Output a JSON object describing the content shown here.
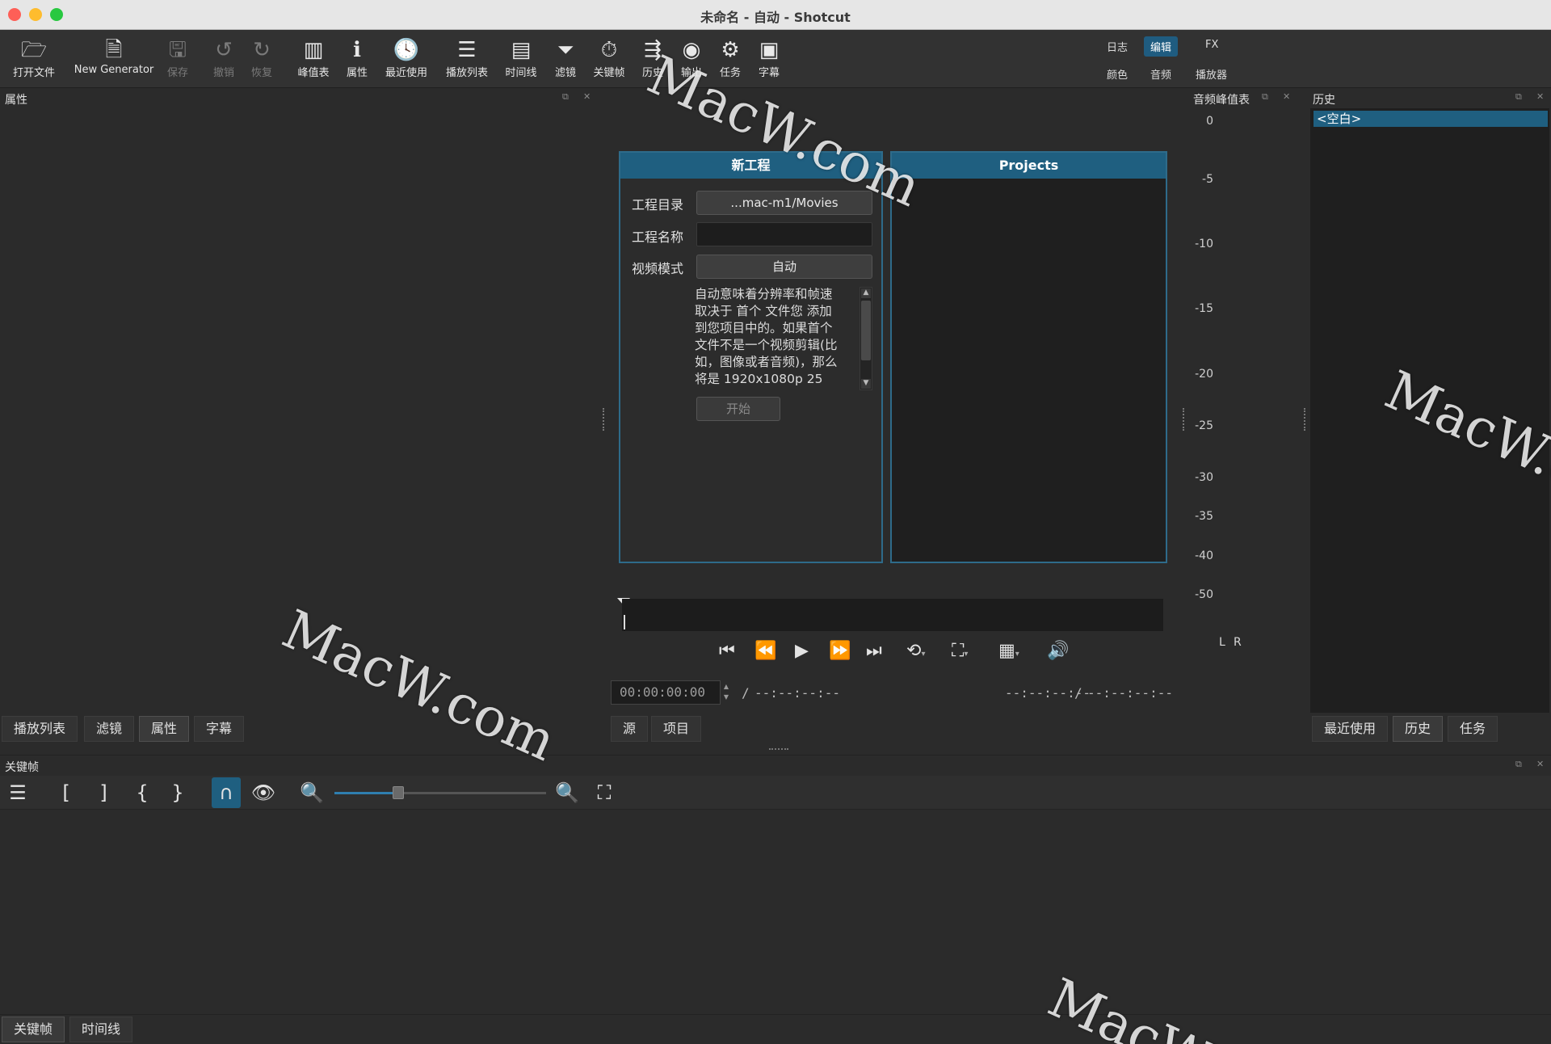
{
  "window": {
    "title": "未命名 - 自动 - Shotcut"
  },
  "toolbar": {
    "open_file": "打开文件",
    "new_generator": "New Generator",
    "save": "保存",
    "undo": "撤销",
    "redo": "恢复",
    "peak_meter": "峰值表",
    "properties": "属性",
    "recent": "最近使用",
    "playlist": "播放列表",
    "timeline": "时间线",
    "filters": "滤镜",
    "keyframes": "关键帧",
    "history": "历史",
    "export": "输出",
    "jobs": "任务",
    "subtitles": "字幕"
  },
  "workspaces": {
    "row1": [
      "日志",
      "编辑",
      "FX"
    ],
    "row2": [
      "颜色",
      "音频",
      "播放器"
    ],
    "active": "编辑"
  },
  "left_panel": {
    "title": "属性",
    "tabs": [
      "播放列表",
      "滤镜",
      "属性",
      "字幕"
    ],
    "active_tab": "属性"
  },
  "new_project": {
    "header": "新工程",
    "dir_label": "工程目录",
    "dir_value": "...mac-m1/Movies",
    "name_label": "工程名称",
    "name_value": "",
    "mode_label": "视频模式",
    "mode_value": "自动",
    "description_lines": [
      "自动意味着分辨率和帧速",
      "取决于 首个 文件您 添加",
      "到您项目中的。如果首个",
      "文件不是一个视频剪辑(比",
      "如，图像或者音频)，那么",
      "将是 1920x1080p 25"
    ],
    "start_button": "开始"
  },
  "projects": {
    "header": "Projects"
  },
  "player": {
    "timecode": "00:00:00:00",
    "slash": "/",
    "duration": "--:--:--:--",
    "in_point": "--:--:--:--",
    "out_point": "--:--:--:--",
    "tabs": [
      "源",
      "项目"
    ]
  },
  "audio_meter": {
    "title": "音频峰值表",
    "ticks": [
      "0",
      "-5",
      "-10",
      "-15",
      "-20",
      "-25",
      "-30",
      "-35",
      "-40",
      "-50"
    ],
    "channels": [
      "L",
      "R"
    ]
  },
  "history_panel": {
    "title": "历史",
    "items": [
      "<空白>"
    ],
    "tabs": [
      "最近使用",
      "历史",
      "任务"
    ],
    "active_tab": "历史"
  },
  "keyframes_panel": {
    "title": "关键帧",
    "zoom_level": 0.3,
    "bottom_tabs": [
      "关键帧",
      "时间线"
    ]
  },
  "watermarks": [
    "MacW.com",
    "MacW.com",
    "MacW.c",
    "MacW"
  ],
  "colors": {
    "accent": "#1f5f80",
    "background": "#2b2b2b",
    "dark": "#1f1f1f"
  }
}
